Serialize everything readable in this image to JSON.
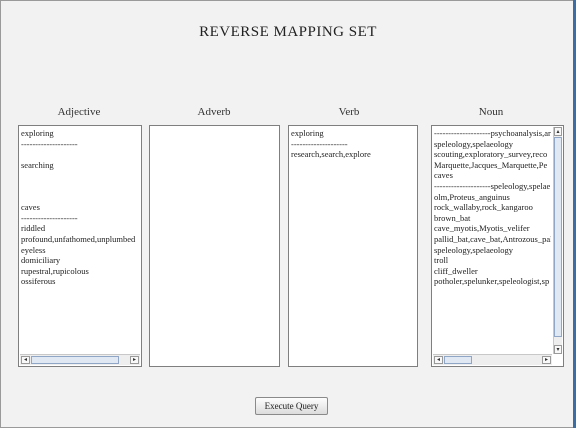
{
  "window": {
    "title": "REVERSE MAPPING SET"
  },
  "columns": [
    {
      "label": "Adjective",
      "lines": [
        "exploring",
        "--------------------",
        "",
        "searching",
        "",
        "",
        "",
        "caves",
        "--------------------",
        "riddled",
        "profound,unfathomed,unplumbed",
        "eyeless",
        "domiciliary",
        "rupestral,rupicolous",
        "ossiferous"
      ]
    },
    {
      "label": "Adverb",
      "lines": []
    },
    {
      "label": "Verb",
      "lines": [
        "exploring",
        "--------------------",
        "research,search,explore"
      ]
    },
    {
      "label": "Noun",
      "lines": [
        "--------------------psychoanalysis,ar",
        "speleology,spelaeology",
        "scouting,exploratory_survey,reco",
        "Marquette,Jacques_Marquette,Pe",
        "caves",
        "--------------------speleology,spelae",
        "olm,Proteus_anguinus",
        "rock_wallaby,rock_kangaroo",
        "brown_bat",
        "cave_myotis,Myotis_velifer",
        "pallid_bat,cave_bat,Antrozous_pal",
        "speleology,spelaeology",
        "troll",
        "cliff_dweller",
        "potholer,spelunker,speleologist,sp"
      ]
    }
  ],
  "scroll_icons": {
    "left": "◂",
    "right": "▸",
    "up": "▴",
    "down": "▾"
  },
  "actions": {
    "execute_label": "Execute Query"
  }
}
